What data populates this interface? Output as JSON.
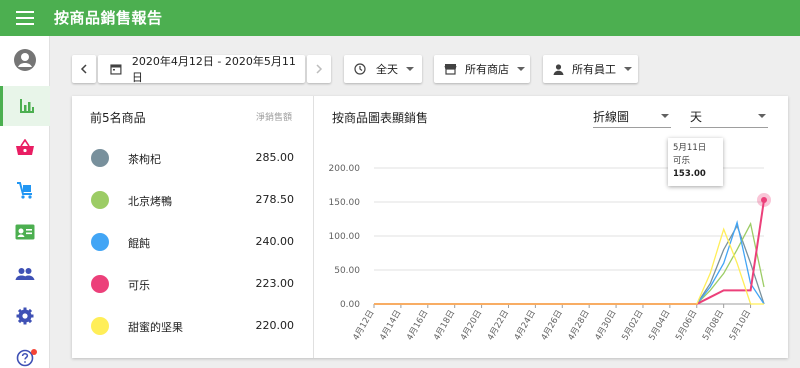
{
  "app": {
    "title": "按商品銷售報告"
  },
  "colors": {
    "primary": "#4caf50",
    "sidebar_icon": "#3f51b5",
    "basket": "#e91e63",
    "cart": "#2196f3",
    "person": "#757575"
  },
  "sidebar": {
    "items": [
      {
        "icon": "account-circle-icon"
      },
      {
        "icon": "bar-chart-icon"
      },
      {
        "icon": "basket-icon"
      },
      {
        "icon": "cart-icon"
      },
      {
        "icon": "id-card-icon"
      },
      {
        "icon": "people-icon"
      },
      {
        "icon": "settings-icon"
      },
      {
        "icon": "help-icon"
      }
    ]
  },
  "toolbar": {
    "date_range": "2020年4月12日 - 2020年5月11日",
    "time_label": "全天",
    "store_label": "所有商店",
    "employee_label": "所有員工"
  },
  "top_products": {
    "title": "前5名商品",
    "column_header": "淨銷售額",
    "items": [
      {
        "name": "茶枸杞",
        "value": "285.00",
        "color": "#78909c"
      },
      {
        "name": "北京烤鴨",
        "value": "278.50",
        "color": "#9ccc65"
      },
      {
        "name": "餛飩",
        "value": "240.00",
        "color": "#42a5f5"
      },
      {
        "name": "可乐",
        "value": "223.00",
        "color": "#ec407a"
      },
      {
        "name": "甜蜜的坚果",
        "value": "220.00",
        "color": "#ffee58"
      }
    ]
  },
  "chart_panel": {
    "title": "按商品圖表顯銷售",
    "chart_type_select": "折線圖",
    "period_select": "天"
  },
  "tooltip": {
    "date": "5月11日",
    "item": "可乐",
    "value": "153.00"
  },
  "chart_data": {
    "type": "line",
    "x": [
      "4月12日",
      "4月13日",
      "4月14日",
      "4月15日",
      "4月16日",
      "4月17日",
      "4月18日",
      "4月19日",
      "4月20日",
      "4月21日",
      "4月22日",
      "4月23日",
      "4月24日",
      "4月25日",
      "4月26日",
      "4月27日",
      "4月28日",
      "4月29日",
      "4月30日",
      "5月01日",
      "5月02日",
      "5月03日",
      "5月04日",
      "5月05日",
      "5月06日",
      "5月07日",
      "5月08日",
      "5月09日",
      "5月10日",
      "5月11日"
    ],
    "x_tick_labels": [
      "4月12日",
      "4月14日",
      "4月16日",
      "4月18日",
      "4月20日",
      "4月22日",
      "4月24日",
      "4月26日",
      "4月28日",
      "4月30日",
      "5月02日",
      "5月04日",
      "5月06日",
      "5月08日",
      "5月10日"
    ],
    "ylim": [
      0,
      200
    ],
    "y_ticks": [
      "0.00",
      "50.00",
      "100.00",
      "150.00",
      "200.00"
    ],
    "grid": "horizontal",
    "series": [
      {
        "name": "茶枸杞",
        "color": "#78909c",
        "values": [
          0,
          0,
          0,
          0,
          0,
          0,
          0,
          0,
          0,
          0,
          0,
          0,
          0,
          0,
          0,
          0,
          0,
          0,
          0,
          0,
          0,
          0,
          0,
          0,
          0,
          30,
          80,
          115,
          60,
          0
        ]
      },
      {
        "name": "北京烤鴨",
        "color": "#9ccc65",
        "values": [
          0,
          0,
          0,
          0,
          0,
          0,
          0,
          0,
          0,
          0,
          0,
          0,
          0,
          0,
          0,
          0,
          0,
          0,
          0,
          0,
          0,
          0,
          0,
          0,
          0,
          20,
          45,
          80,
          118,
          25
        ]
      },
      {
        "name": "餛飩",
        "color": "#42a5f5",
        "values": [
          0,
          0,
          0,
          0,
          0,
          0,
          0,
          0,
          0,
          0,
          0,
          0,
          0,
          0,
          0,
          0,
          0,
          0,
          0,
          0,
          0,
          0,
          0,
          0,
          0,
          25,
          60,
          120,
          30,
          0
        ]
      },
      {
        "name": "可乐",
        "color": "#ec407a",
        "values": [
          0,
          0,
          0,
          0,
          0,
          0,
          0,
          0,
          0,
          0,
          0,
          0,
          0,
          0,
          0,
          0,
          0,
          0,
          0,
          0,
          0,
          0,
          0,
          0,
          0,
          10,
          20,
          20,
          20,
          153
        ]
      },
      {
        "name": "甜蜜的坚果",
        "color": "#ffee58",
        "values": [
          0,
          0,
          0,
          0,
          0,
          0,
          0,
          0,
          0,
          0,
          0,
          0,
          0,
          0,
          0,
          0,
          0,
          0,
          0,
          0,
          0,
          0,
          0,
          0,
          0,
          45,
          110,
          60,
          0,
          0
        ]
      }
    ],
    "highlight": {
      "series": "可乐",
      "x": "5月11日",
      "value": 153
    }
  }
}
